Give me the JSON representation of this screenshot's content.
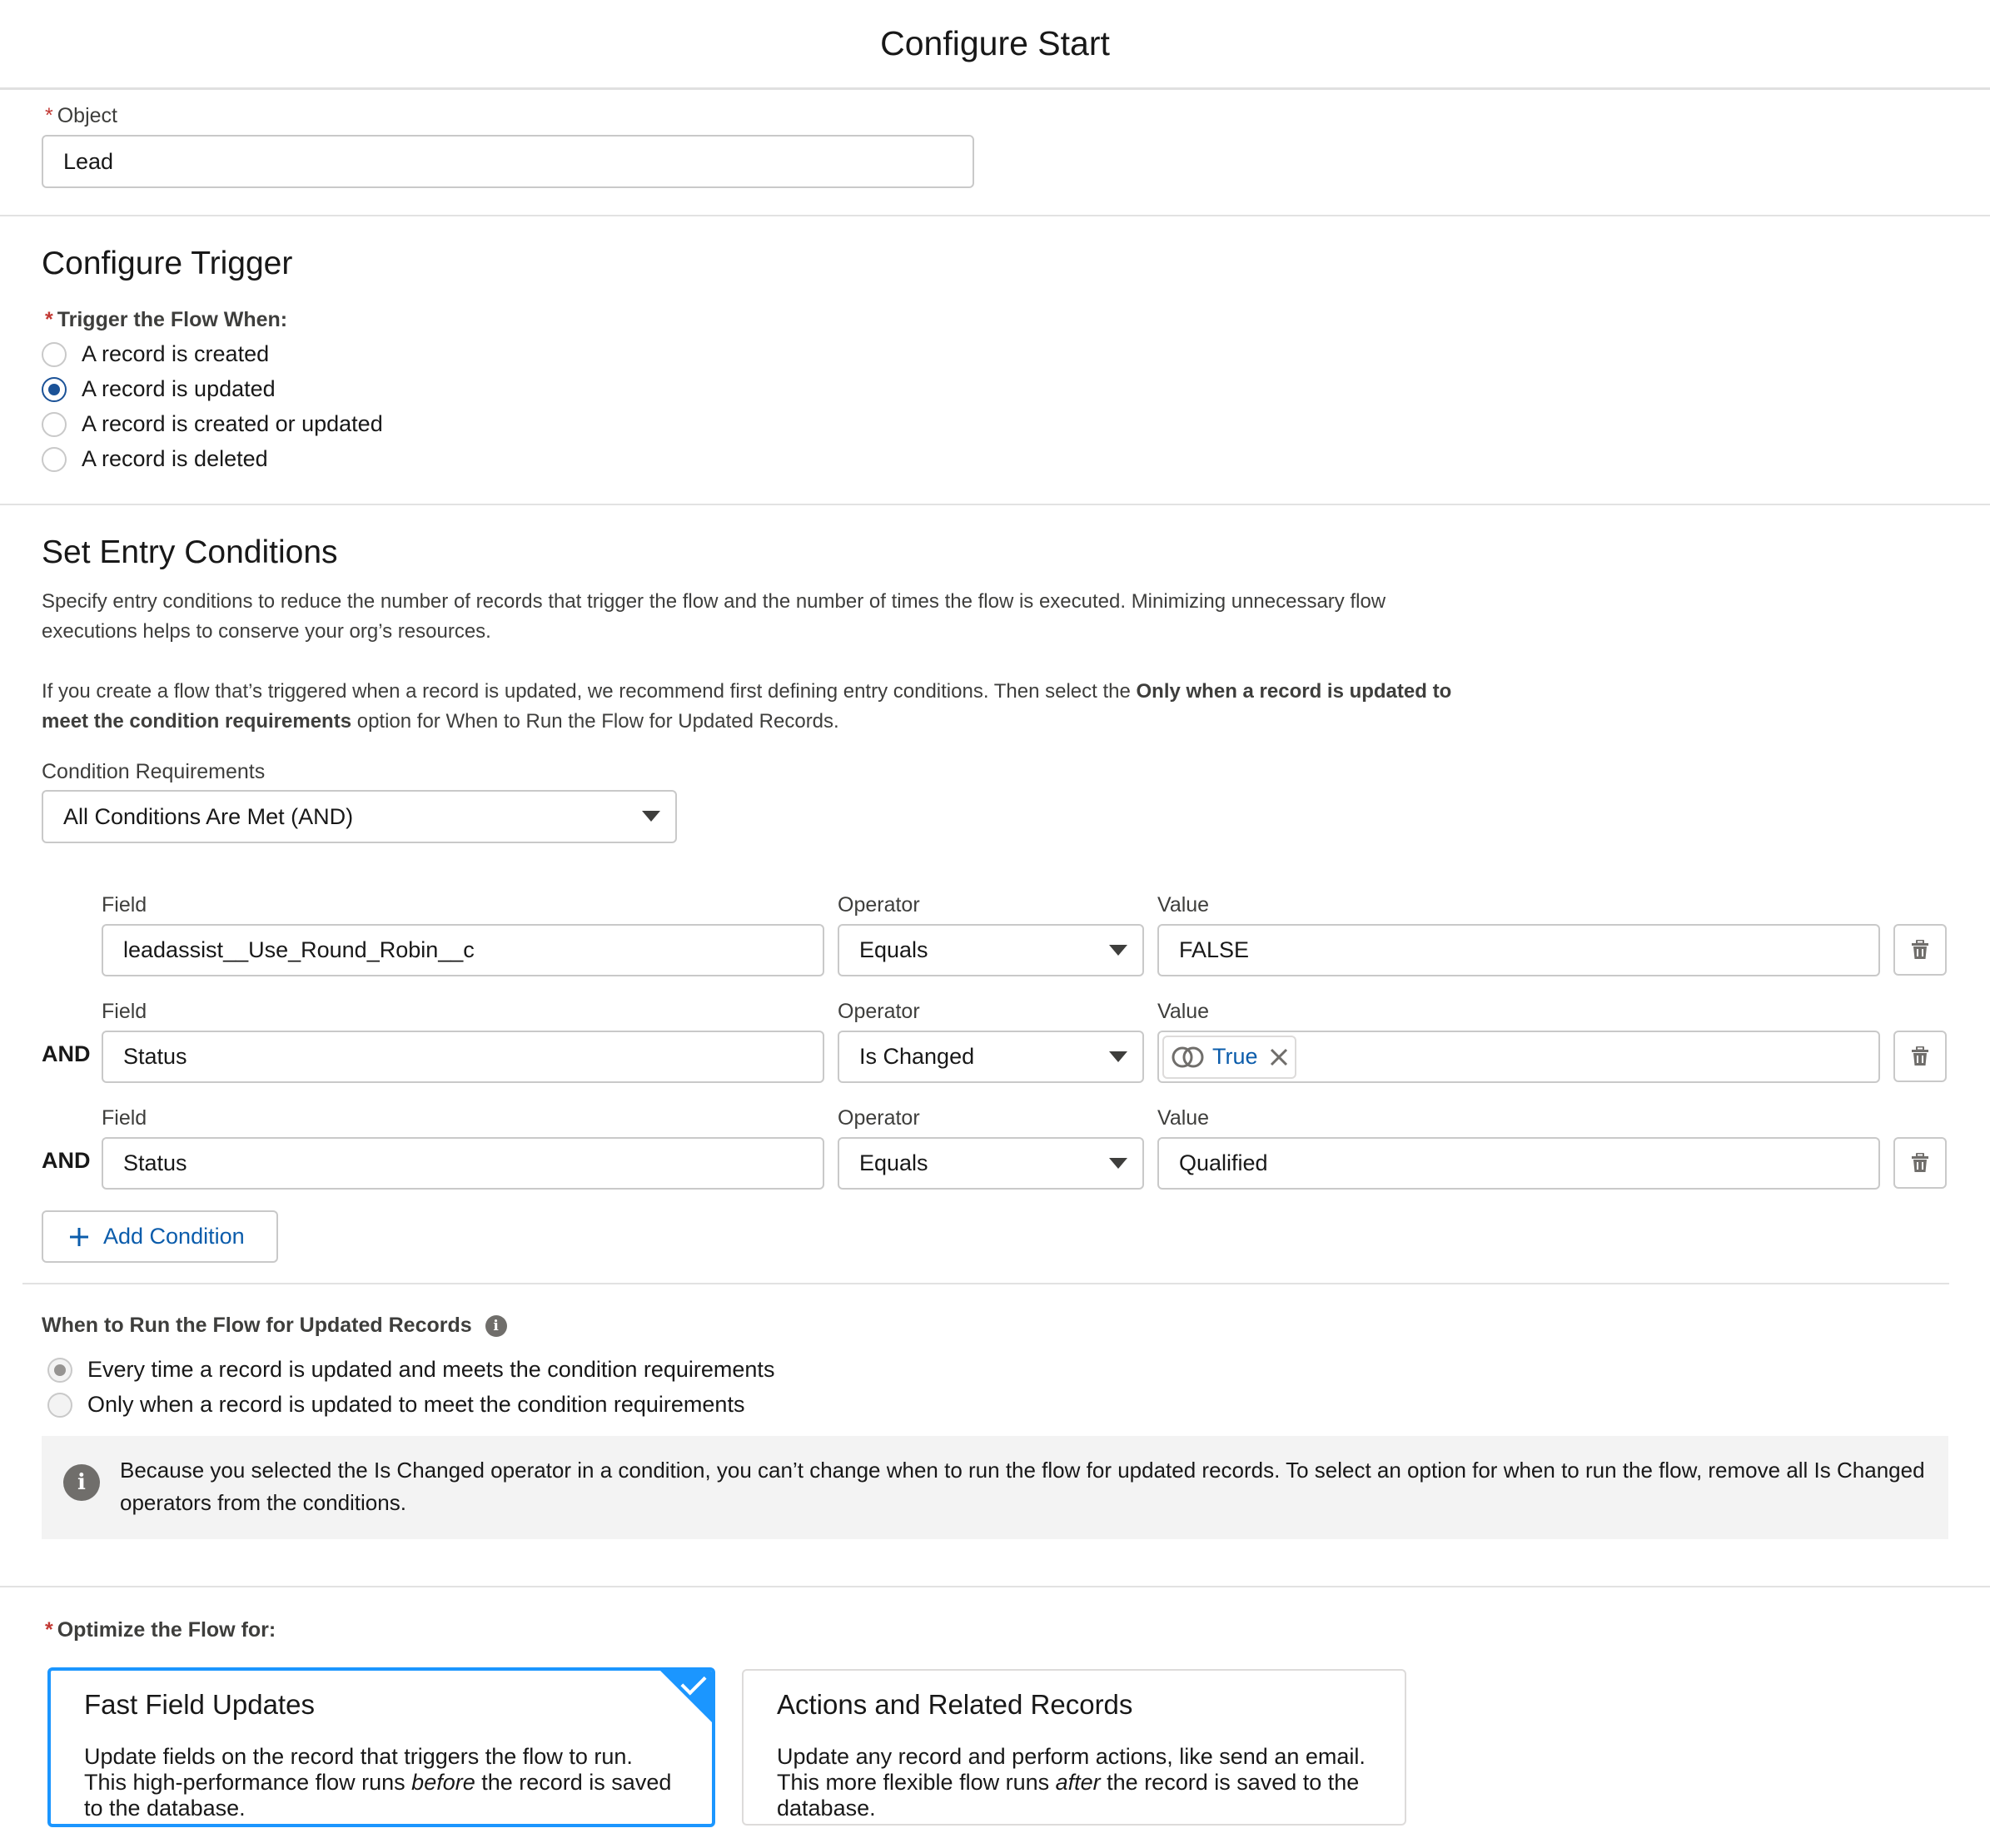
{
  "header": {
    "title": "Configure Start"
  },
  "object": {
    "label": "Object",
    "value": "Lead"
  },
  "trigger": {
    "heading": "Configure Trigger",
    "label": "Trigger the Flow When:",
    "options": [
      {
        "label": "A record is created",
        "checked": false
      },
      {
        "label": "A record is updated",
        "checked": true
      },
      {
        "label": "A record is created or updated",
        "checked": false
      },
      {
        "label": "A record is deleted",
        "checked": false
      }
    ]
  },
  "entry": {
    "heading": "Set Entry Conditions",
    "para1": "Specify entry conditions to reduce the number of records that trigger the flow and the number of times the flow is executed. Minimizing unnecessary flow executions helps to conserve your org’s resources.",
    "para2_pre": "If you create a flow that’s triggered when a record is updated, we recommend first defining entry conditions. Then select the ",
    "para2_bold": "Only when a record is updated to meet the condition requirements",
    "para2_post": " option for When to Run the Flow for Updated Records.",
    "requirements_label": "Condition Requirements",
    "requirements_value": "All Conditions Are Met (AND)",
    "field_label": "Field",
    "operator_label": "Operator",
    "value_label": "Value",
    "and_label": "AND",
    "conditions": [
      {
        "field": "leadassist__Use_Round_Robin__c",
        "operator": "Equals",
        "value": "FALSE"
      },
      {
        "field": "Status",
        "operator": "Is Changed",
        "value": "True"
      },
      {
        "field": "Status",
        "operator": "Equals",
        "value": "Qualified"
      }
    ],
    "add_condition": "Add Condition"
  },
  "when_run": {
    "label": "When to Run the Flow for Updated Records",
    "options": [
      {
        "label": "Every time a record is updated and meets the condition requirements",
        "checked": true
      },
      {
        "label": "Only when a record is updated to meet the condition requirements",
        "checked": false
      }
    ],
    "info_text": "Because you selected the Is Changed operator in a condition, you can’t change when to run the flow for updated records. To select an option for when to run the flow, remove all Is Changed operators from the conditions."
  },
  "optimize": {
    "label": "Optimize the Flow for:",
    "cards": [
      {
        "title": "Fast Field Updates",
        "desc_pre": "Update fields on the record that triggers the flow to run. This high-performance flow runs ",
        "desc_em": "before",
        "desc_post": " the record is saved to the database.",
        "selected": true
      },
      {
        "title": "Actions and Related Records",
        "desc_pre": "Update any record and perform actions, like send an email. This more flexible flow runs ",
        "desc_em": "after",
        "desc_post": " the record is saved to the database.",
        "selected": false
      }
    ]
  },
  "colors": {
    "brand": "#1b5297",
    "accent": "#1b96ff",
    "link": "#0b5cab",
    "required": "#c23934"
  }
}
